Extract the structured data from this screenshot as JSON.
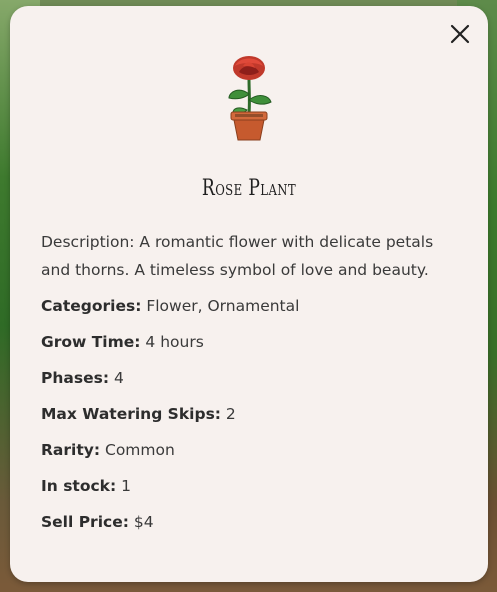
{
  "dialog": {
    "title": "Rose Plant",
    "icon": "close-icon",
    "plant_icon": "rose-plant-icon",
    "accent": "#c0392b"
  },
  "details": {
    "description_label": "Description:",
    "description_value": " A romantic flower with delicate petals and thorns. A timeless symbol of love and beauty.",
    "categories_label": "Categories:",
    "categories_value": " Flower, Ornamental",
    "grow_time_label": "Grow Time:",
    "grow_time_value": " 4 hours",
    "phases_label": "Phases:",
    "phases_value": " 4",
    "max_watering_skips_label": "Max Watering Skips:",
    "max_watering_skips_value": " 2",
    "rarity_label": "Rarity:",
    "rarity_value": " Common",
    "in_stock_label": "In stock:",
    "in_stock_value": " 1",
    "sell_price_label": "Sell Price:",
    "sell_price_value": " $4"
  }
}
